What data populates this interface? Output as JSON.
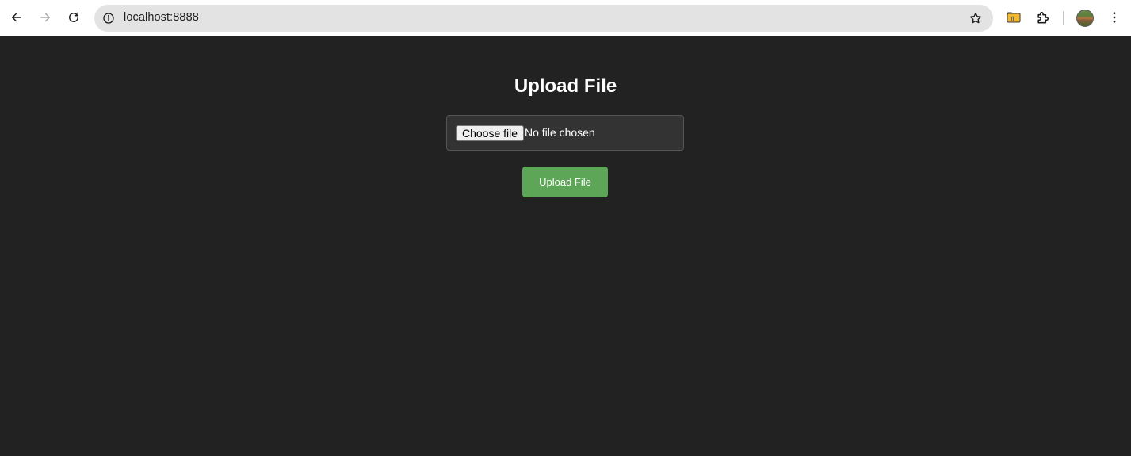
{
  "browser": {
    "url": "localhost:8888",
    "icons": {
      "back": "arrow-left-icon",
      "forward": "arrow-right-icon",
      "reload": "reload-icon",
      "site_info": "info-icon",
      "bookmark": "star-icon",
      "extension_folder": "folder-icon",
      "extensions": "puzzle-icon",
      "menu": "kebab-menu-icon"
    }
  },
  "page": {
    "title": "Upload File",
    "file_input": {
      "button_label": "Choose file",
      "status": "No file chosen"
    },
    "upload_button_label": "Upload File"
  },
  "colors": {
    "page_background": "#222222",
    "upload_button": "#5da657",
    "file_box_background": "#333333"
  }
}
